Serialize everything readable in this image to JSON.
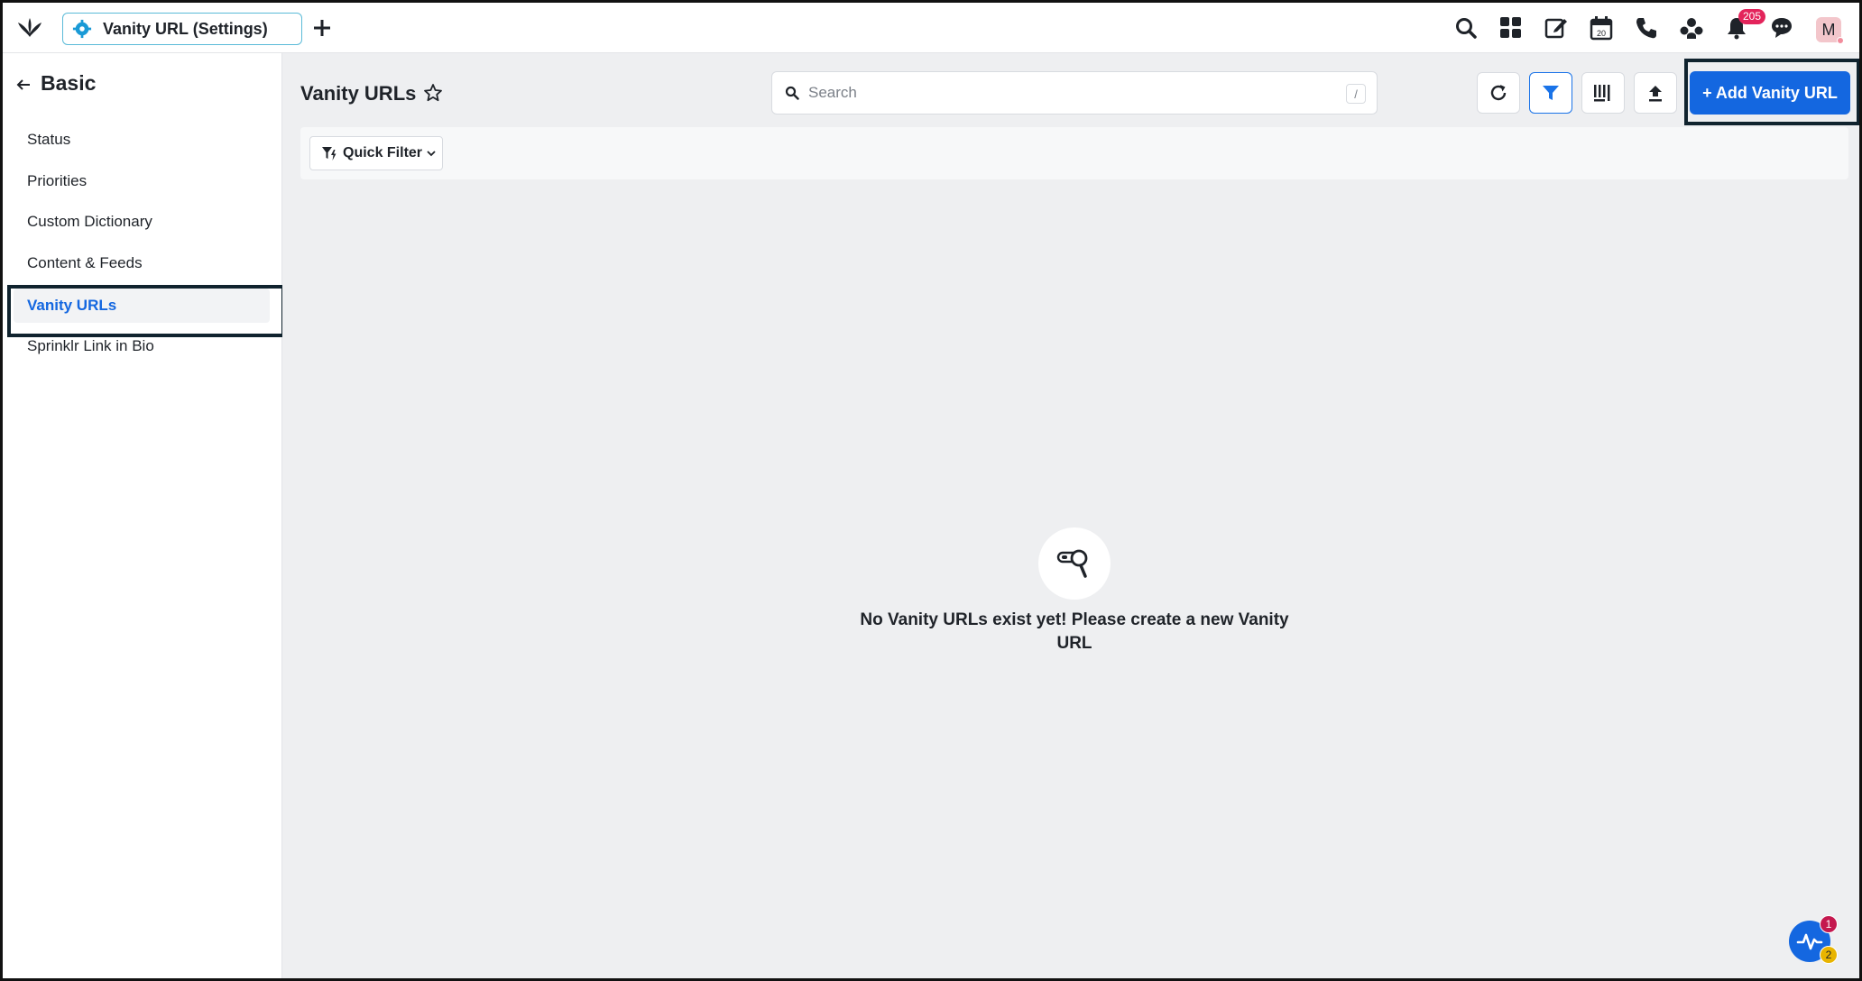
{
  "header": {
    "tab_label": "Vanity URL (Settings)",
    "notification_count": "205",
    "avatar_initial": "M",
    "calendar_day": "20"
  },
  "sidebar": {
    "title": "Basic",
    "items": [
      {
        "label": "Status",
        "active": false
      },
      {
        "label": "Priorities",
        "active": false
      },
      {
        "label": "Custom Dictionary",
        "active": false
      },
      {
        "label": "Content & Feeds",
        "active": false
      },
      {
        "label": "Vanity URLs",
        "active": true
      },
      {
        "label": "Sprinklr Link in Bio",
        "active": false
      }
    ]
  },
  "main": {
    "title": "Vanity URLs",
    "search_placeholder": "Search",
    "search_shortcut": "/",
    "add_button_label": "+ Add Vanity URL",
    "quick_filter_label": "Quick Filter",
    "empty_message": "No Vanity URLs exist yet! Please create a new Vanity URL"
  },
  "pulse_widget": {
    "badge_top": "1",
    "badge_bottom": "2"
  },
  "colors": {
    "accent": "#1467e0",
    "badge": "#e3245b",
    "highlight_outline": "#10232e"
  }
}
